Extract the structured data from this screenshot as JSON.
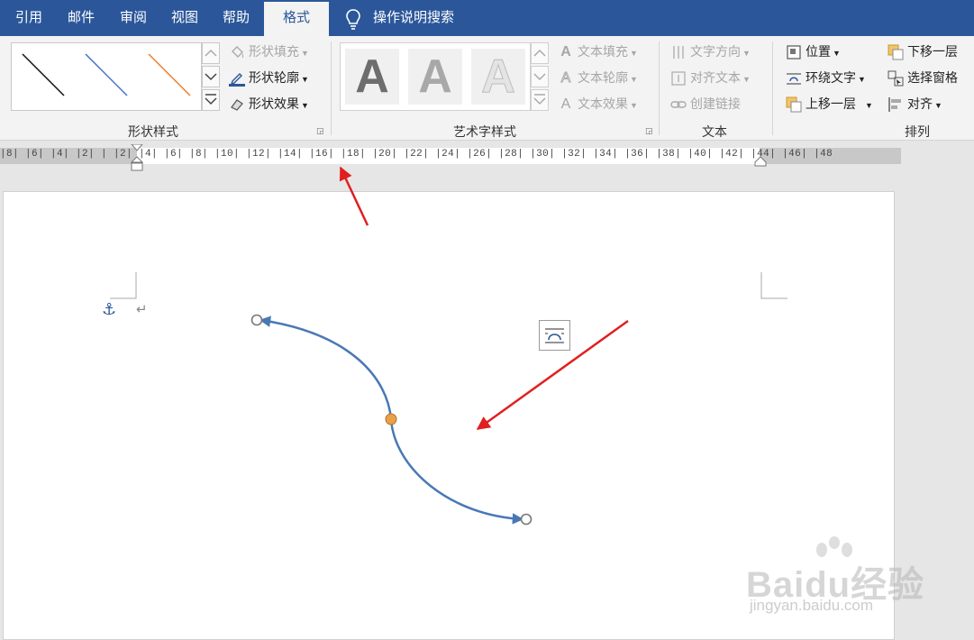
{
  "tabs": [
    {
      "label": "引用",
      "active": false
    },
    {
      "label": "邮件",
      "active": false
    },
    {
      "label": "审阅",
      "active": false
    },
    {
      "label": "视图",
      "active": false
    },
    {
      "label": "帮助",
      "active": false
    },
    {
      "label": "格式",
      "active": true
    }
  ],
  "tell_me": "操作说明搜索",
  "groups": {
    "shape_styles": {
      "label": "形状样式",
      "fill": "形状填充",
      "outline": "形状轮廓",
      "effects": "形状效果"
    },
    "wordart": {
      "label": "艺术字样式",
      "letters": [
        "A",
        "A",
        "A"
      ],
      "text_fill": "文本填充",
      "text_outline": "文本轮廓",
      "text_effects": "文本效果"
    },
    "text": {
      "label": "文本",
      "direction": "文字方向",
      "align": "对齐文本",
      "link": "创建链接"
    },
    "arrange": {
      "label": "排列",
      "position": "位置",
      "wrap": "环绕文字",
      "forward": "上移一层",
      "backward": "下移一层",
      "selection_pane": "选择窗格",
      "align": "对齐"
    }
  },
  "ruler_text": "|8|  |6|  |4|  |2|  |  |2|  |4|  |6|  |8|  |10|  |12|  |14|  |16|  |18|  |20|  |22|  |24|  |26|  |28|  |30|  |32|  |34|  |36|  |38|  |40|  |42|  |44|  |46|  |48",
  "watermark": {
    "brand": "Baidu经验",
    "url": "jingyan.baidu.com"
  },
  "colors": {
    "tabbar": "#2b579a",
    "curve": "#4a78b5",
    "annotation_arrow": "#e02020",
    "handle_center": "#e8a04a"
  }
}
